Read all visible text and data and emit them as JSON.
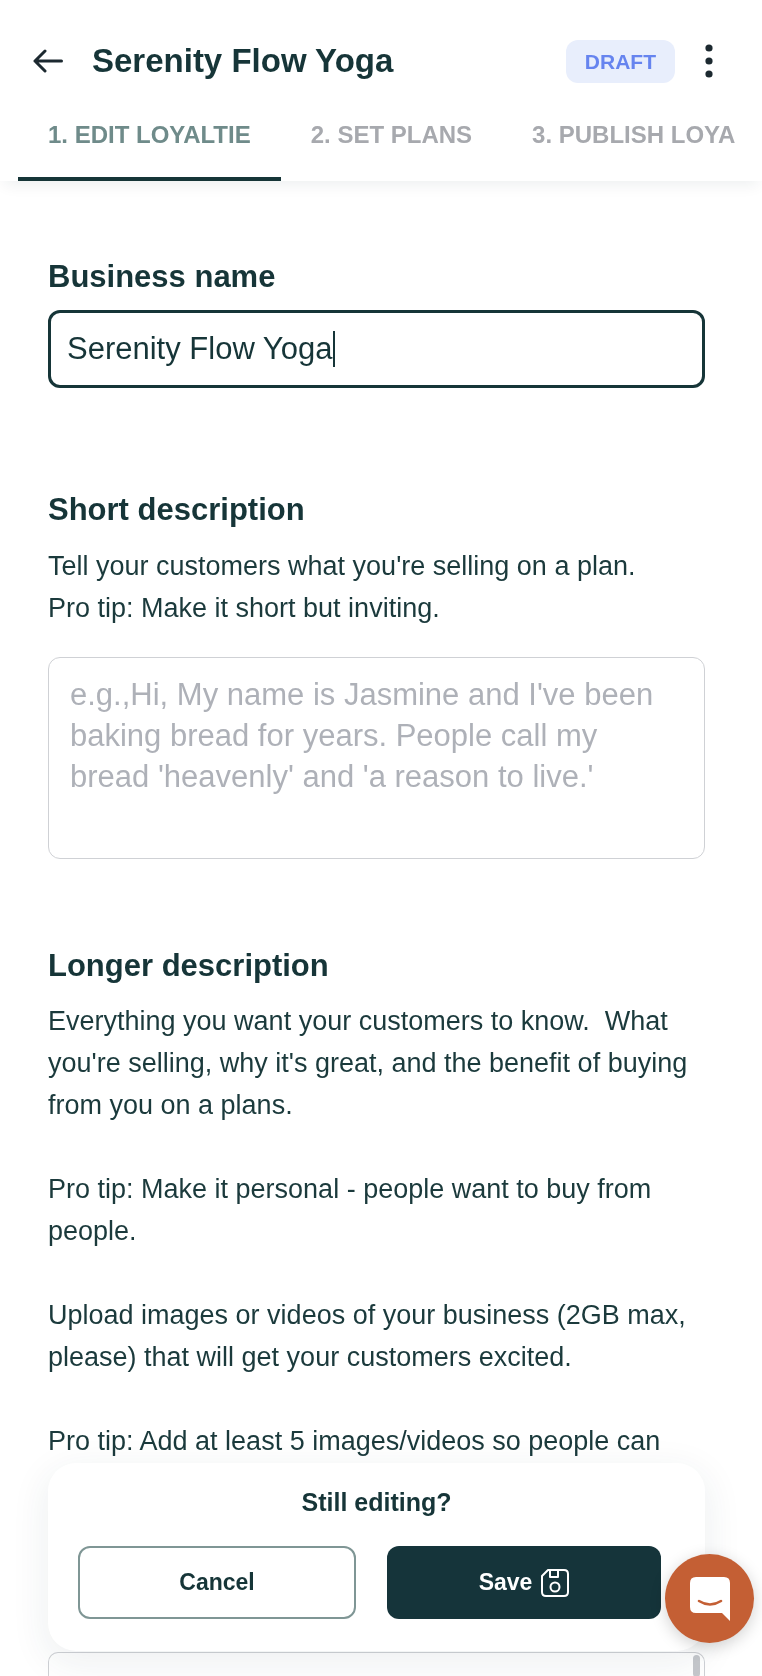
{
  "header": {
    "title": "Serenity Flow Yoga",
    "status": "DRAFT"
  },
  "tabs": [
    {
      "label": "1. EDIT LOYALTIE",
      "selected": true
    },
    {
      "label": "2. SET PLANS",
      "selected": false
    },
    {
      "label": "3. PUBLISH LOYA",
      "selected": false
    }
  ],
  "form": {
    "business_name": {
      "label": "Business name",
      "value": "Serenity Flow Yoga",
      "focused": true
    },
    "short_description": {
      "label": "Short description",
      "hint_lines": [
        "Tell your customers what you're selling on a plan.",
        "Pro tip: Make it short but inviting."
      ],
      "placeholder": "e.g.,Hi, My name is Jasmine and I've been baking bread for years. People call my bread 'heavenly' and 'a reason to live.'",
      "focused": false
    },
    "longer_description": {
      "label": "Longer description",
      "hint_paragraphs": [
        "Everything you want your customers to know.  What you're selling, why it's great, and the benefit of buying from you on a plans.",
        "Pro tip: Make it personal - people want to buy from people.",
        "Upload images or videos of your business (2GB max, please) that will get your customers excited.",
        "Pro tip: Add at least 5 images/videos so people can"
      ],
      "focused": false
    }
  },
  "save_prompt": {
    "title": "Still editing?",
    "buttons": [
      {
        "label": "Cancel",
        "kind": "secondary"
      },
      {
        "label": "Save",
        "kind": "primary"
      }
    ]
  }
}
